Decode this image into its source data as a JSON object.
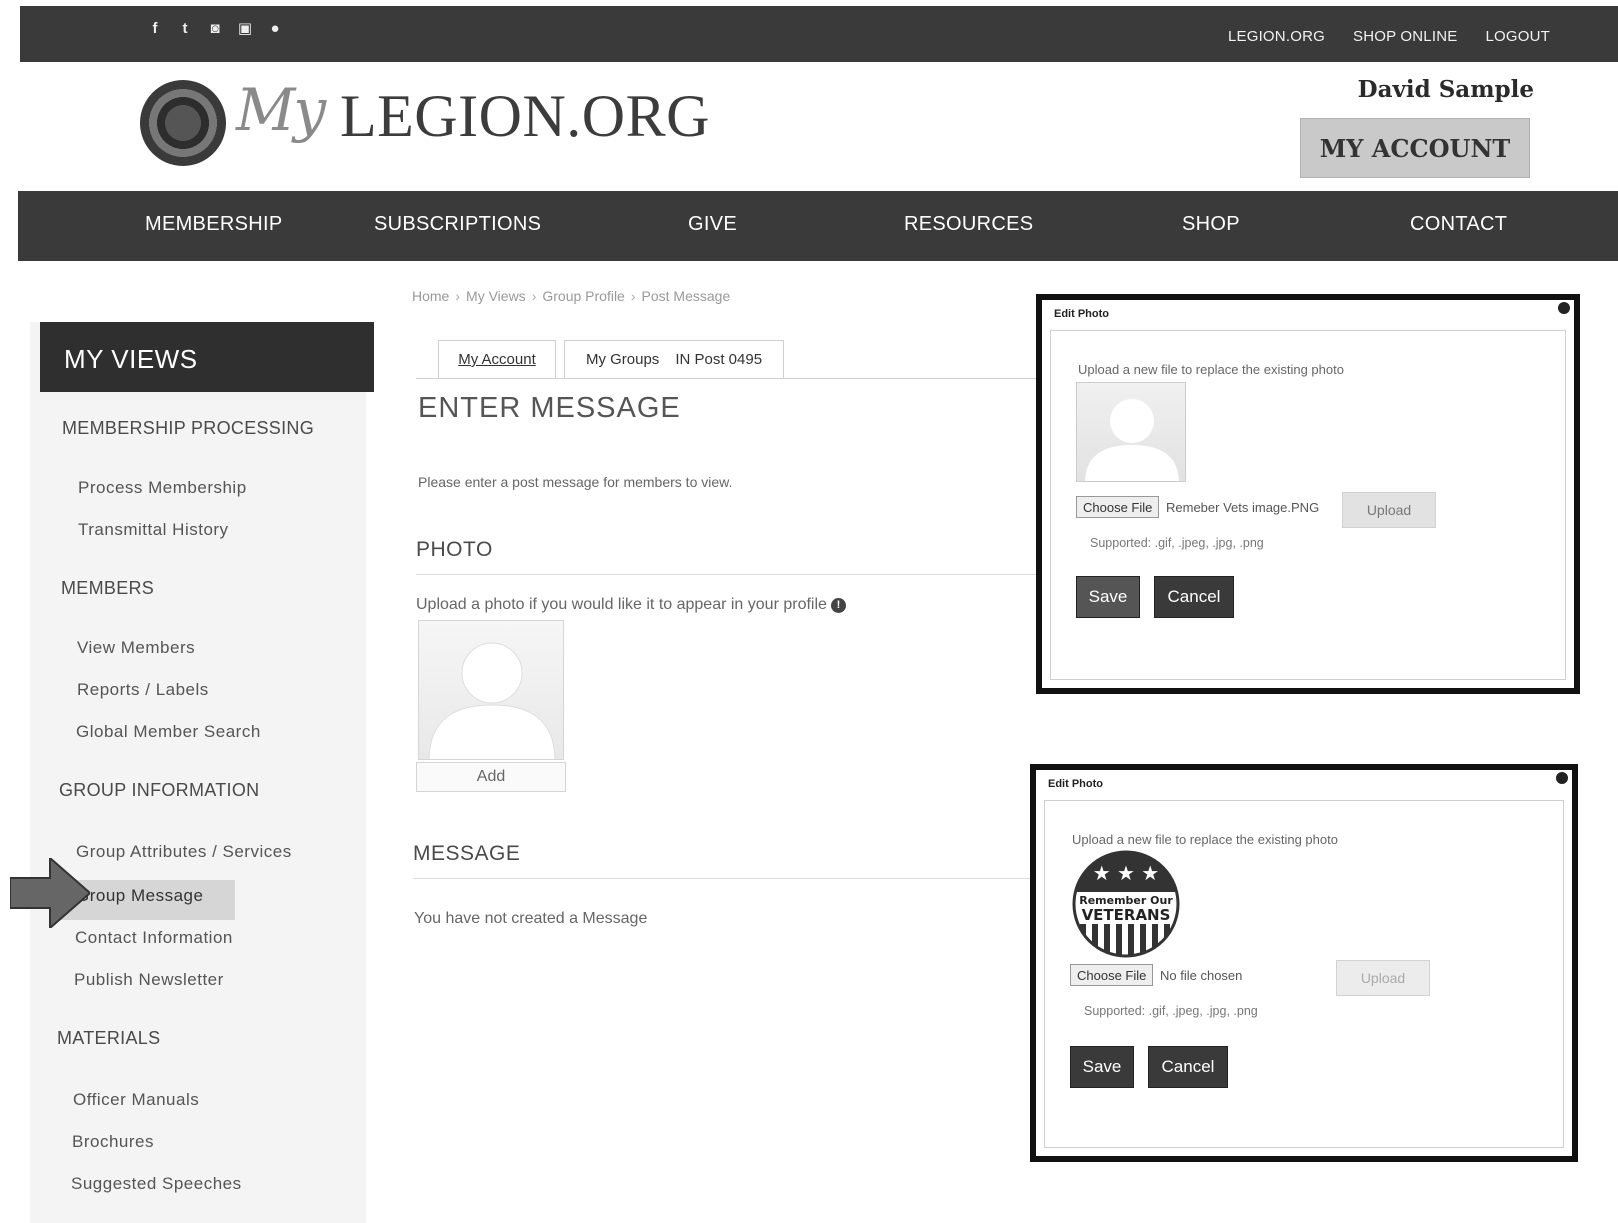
{
  "topbar": {
    "social_icons": [
      "facebook-icon",
      "twitter-icon",
      "instagram-icon",
      "youtube-icon",
      "pinterest-icon"
    ],
    "links": [
      "LEGION.ORG",
      "SHOP ONLINE",
      "LOGOUT"
    ]
  },
  "header": {
    "logo_my": "My",
    "logo_text": "LEGION.ORG",
    "user_name": "David Sample",
    "my_account": "MY ACCOUNT"
  },
  "nav": [
    "MEMBERSHIP",
    "SUBSCRIPTIONS",
    "GIVE",
    "RESOURCES",
    "SHOP",
    "CONTACT"
  ],
  "sidebar": {
    "title": "MY VIEWS",
    "sections": [
      {
        "title": "MEMBERSHIP PROCESSING",
        "items": [
          "Process Membership",
          "Transmittal History"
        ]
      },
      {
        "title": "MEMBERS",
        "items": [
          "View Members",
          "Reports / Labels",
          "Global Member Search"
        ]
      },
      {
        "title": "GROUP INFORMATION",
        "items": [
          "Group Attributes / Services",
          "Group Message",
          "Contact Information",
          "Publish Newsletter"
        ]
      },
      {
        "title": "MATERIALS",
        "items": [
          "Officer Manuals",
          "Brochures",
          "Suggested Speeches"
        ]
      }
    ],
    "active_item": "Group Message"
  },
  "breadcrumb": [
    "Home",
    "My Views",
    "Group Profile",
    "Post Message"
  ],
  "tabs": {
    "my_account": "My Account",
    "my_groups": "My Groups",
    "post": "IN Post 0495"
  },
  "content": {
    "title": "ENTER MESSAGE",
    "intro": "Please enter a post message for members to view.",
    "photo_title": "PHOTO",
    "photo_hint": "Upload a photo if you would like it to appear in your profile",
    "add_label": "Add",
    "message_title": "MESSAGE",
    "no_message": "You have not created a Message"
  },
  "dialogs": [
    {
      "title": "Edit Photo",
      "instruction": "Upload a new file to replace the existing photo",
      "choose_file": "Choose File",
      "file_name": "Remeber Vets image.PNG",
      "upload": "Upload",
      "supported": "Supported: .gif, .jpeg, .jpg, .png",
      "save": "Save",
      "cancel": "Cancel"
    },
    {
      "title": "Edit Photo",
      "instruction": "Upload a new file to replace the existing photo",
      "choose_file": "Choose File",
      "file_name": "No file chosen",
      "upload": "Upload",
      "supported": "Supported: .gif, .jpeg, .jpg, .png",
      "save": "Save",
      "cancel": "Cancel",
      "badge_line1": "Remember Our",
      "badge_line2": "VETERANS"
    }
  ]
}
